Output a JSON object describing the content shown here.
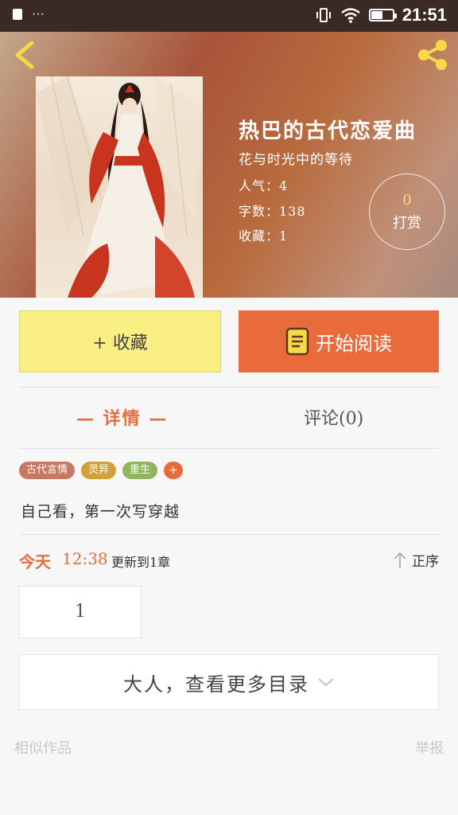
{
  "status_bar": {
    "notification_dots": "···",
    "time": "21:51",
    "battery_level": 0.55
  },
  "book": {
    "title": "热巴的古代恋爱曲",
    "subtitle": "花与时光中的等待",
    "popularity": "人气：4",
    "word_count": "字数：138",
    "favorites": "收藏：1",
    "tip_count": "0",
    "tip_label": "打赏"
  },
  "actions": {
    "collect_label": "+ 收藏",
    "read_label": "开始阅读"
  },
  "tabs": {
    "details": "— 详情 —",
    "comments": "评论(0)"
  },
  "tags": [
    {
      "label": "古代言情",
      "color": "#c57961"
    },
    {
      "label": "灵异",
      "color": "#d3a13c"
    },
    {
      "label": "重生",
      "color": "#8fb55e"
    }
  ],
  "tag_add": "+",
  "description": "自己看，第一次写穿越",
  "update": {
    "today": "今天",
    "time": "12:38",
    "text": "更新到1章",
    "sort_label": "正序"
  },
  "chapter": {
    "number": "1"
  },
  "more_catalog": "大人，查看更多目录",
  "footer": {
    "similar": "相似作品",
    "report": "举报"
  },
  "colors": {
    "accent": "#e96b3c",
    "collect_bg": "#f9ef82",
    "icon_yellow": "#f7d948"
  }
}
